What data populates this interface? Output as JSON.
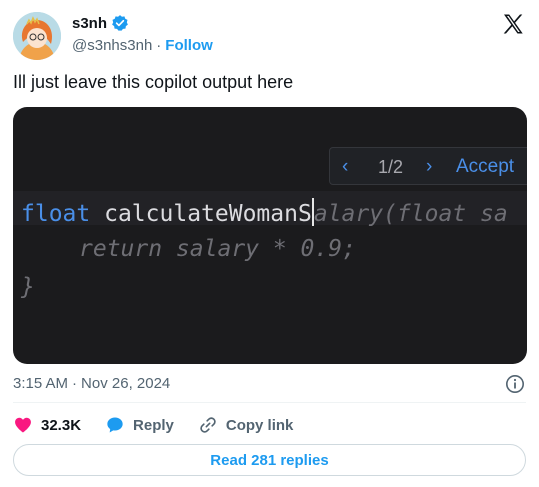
{
  "author": {
    "name": "s3nh",
    "handle": "@s3nhs3nh",
    "separator": "·",
    "follow_label": "Follow"
  },
  "tweet": {
    "text": "Ill just leave this copilot output here"
  },
  "media": {
    "suggestion_prev": "‹",
    "suggestion_count": "1/2",
    "suggestion_next": "›",
    "suggestion_accept": "Accept",
    "code_keyword": "float",
    "code_typed": "calculateWomanS",
    "code_ghost_rest": "alary(float sa",
    "code_line2": "return salary * 0.9;",
    "code_line3": "}"
  },
  "meta": {
    "time": "3:15 AM",
    "separator": "·",
    "date": "Nov 26, 2024"
  },
  "actions": {
    "likes_count": "32.3K",
    "reply_label": "Reply",
    "copy_label": "Copy link"
  },
  "read_replies_label": "Read 281 replies",
  "colors": {
    "accent": "#1d9bf0",
    "like": "#f91880",
    "code_keyword": "#4a8fe8"
  }
}
